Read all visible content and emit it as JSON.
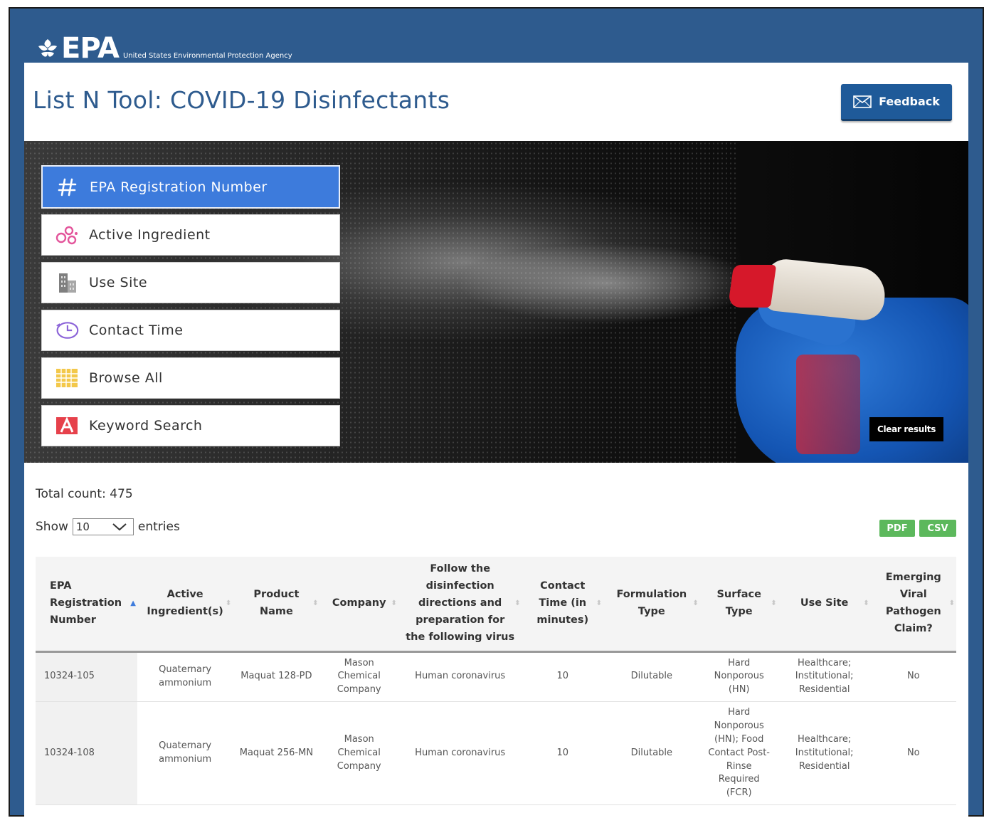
{
  "header": {
    "logo_text": "EPA",
    "agency_name": "United States Environmental Protection Agency"
  },
  "page": {
    "title": "List N Tool: COVID-19 Disinfectants",
    "feedback_label": "Feedback"
  },
  "menu": {
    "items": [
      {
        "label": "EPA Registration Number",
        "icon": "hash-icon",
        "active": true
      },
      {
        "label": "Active Ingredient",
        "icon": "molecule-icon",
        "active": false
      },
      {
        "label": "Use Site",
        "icon": "building-icon",
        "active": false
      },
      {
        "label": "Contact Time",
        "icon": "clock-icon",
        "active": false
      },
      {
        "label": "Browse All",
        "icon": "grid-icon",
        "active": false
      },
      {
        "label": "Keyword Search",
        "icon": "letter-a-icon",
        "active": false
      }
    ],
    "clear_results_label": "Clear results"
  },
  "results": {
    "total_count_label": "Total count: 475",
    "show_label": "Show",
    "entries_value": "10",
    "entries_label": "entries",
    "export_pdf": "PDF",
    "export_csv": "CSV"
  },
  "table": {
    "headers": [
      "EPA Registration Number",
      "Active Ingredient(s)",
      "Product Name",
      "Company",
      "Follow the disinfection directions and preparation for the following virus",
      "Contact Time (in minutes)",
      "Formulation Type",
      "Surface Type",
      "Use Site",
      "Emerging Viral Pathogen Claim?"
    ],
    "rows": [
      [
        "10324-105",
        "Quaternary ammonium",
        "Maquat 128-PD",
        "Mason Chemical Company",
        "Human coronavirus",
        "10",
        "Dilutable",
        "Hard Nonporous (HN)",
        "Healthcare; Institutional; Residential",
        "No"
      ],
      [
        "10324-108",
        "Quaternary ammonium",
        "Maquat 256-MN",
        "Mason Chemical Company",
        "Human coronavirus",
        "10",
        "Dilutable",
        "Hard Nonporous (HN); Food Contact Post-Rinse Required (FCR)",
        "Healthcare; Institutional; Residential",
        "No"
      ]
    ]
  },
  "colors": {
    "brand_blue": "#2e5b8e",
    "active_menu": "#3d7bdc",
    "export_green": "#5cb85c"
  }
}
